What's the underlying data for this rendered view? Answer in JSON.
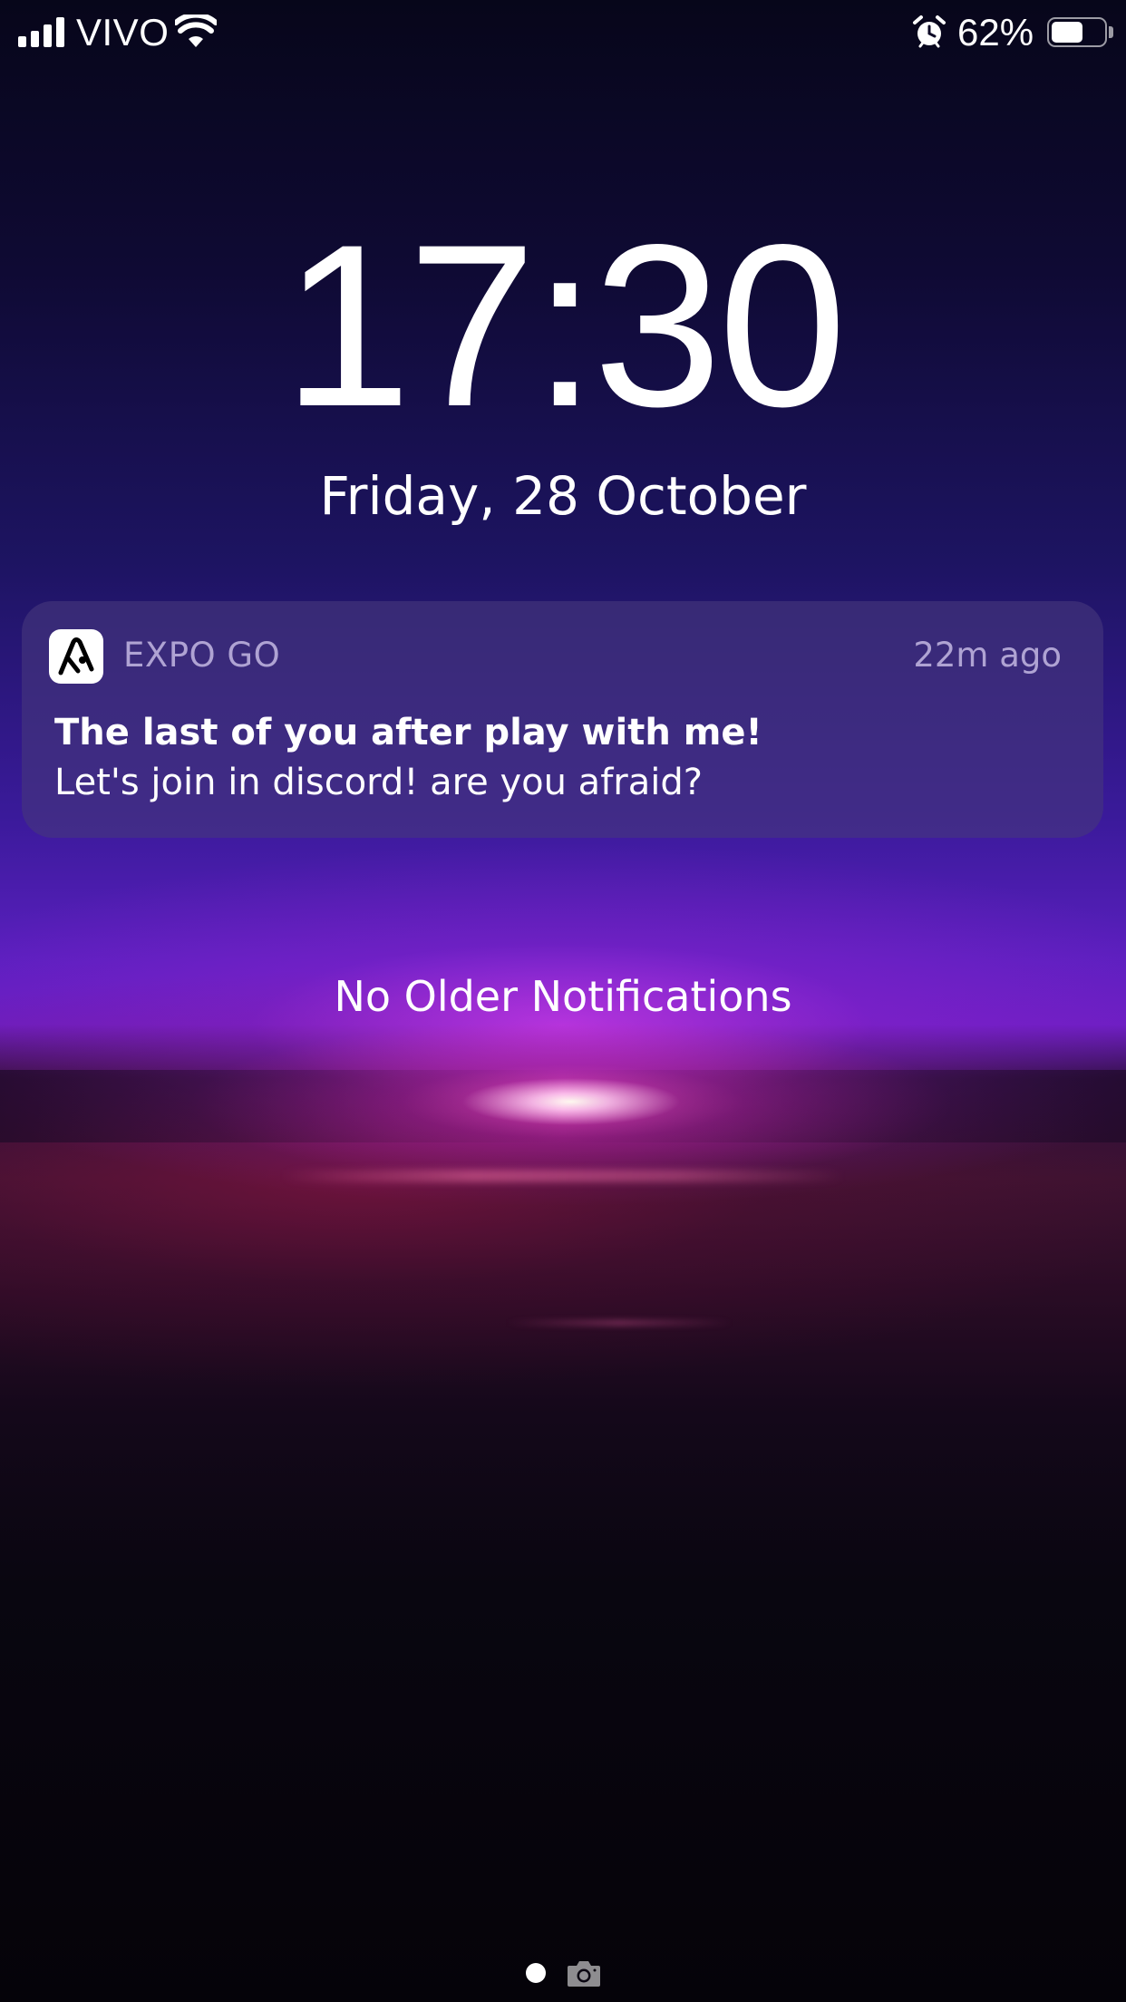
{
  "status_bar": {
    "carrier": "VIVO",
    "battery_percent_label": "62%",
    "battery_level": 0.62,
    "signal_bars": 4,
    "icons": [
      "signal-icon",
      "wifi-icon",
      "alarm-icon",
      "battery-icon"
    ]
  },
  "lock_screen": {
    "time": "17:30",
    "date": "Friday, 28 October"
  },
  "notification": {
    "app_name": "EXPO GO",
    "time_ago": "22m ago",
    "title": "The last of you after play with me!",
    "body": "Let's join in discord! are you afraid?",
    "icon": "expo-go-app-icon"
  },
  "no_older_notifications": "No Older Notifications",
  "footer": {
    "icons": [
      "page-indicator-dot",
      "camera-icon"
    ]
  },
  "colors": {
    "notification_background": "#46377d",
    "secondary_text": "#dcd2f5",
    "accent_glow": "#ff50c8"
  }
}
